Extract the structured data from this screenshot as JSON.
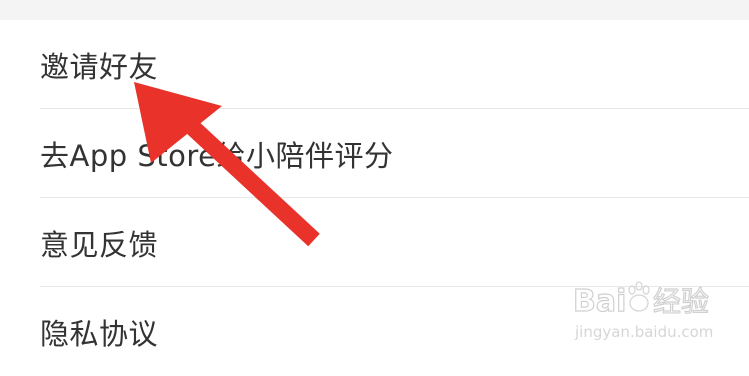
{
  "menu": {
    "items": [
      {
        "label": "邀请好友"
      },
      {
        "label": "去App Store给小陪伴评分"
      },
      {
        "label": "意见反馈"
      },
      {
        "label": "隐私协议"
      }
    ]
  },
  "annotation": {
    "arrow_color": "#e8322a",
    "arrow_icon": "red-arrow-annotation"
  },
  "watermark": {
    "logo_text": "Bai",
    "product_text": "经验",
    "url_text": "jingyan.baidu.com"
  },
  "colors": {
    "text": "#333333",
    "divider": "#e7e7e7",
    "top_band": "#f4f4f4",
    "arrow": "#e8322a"
  }
}
